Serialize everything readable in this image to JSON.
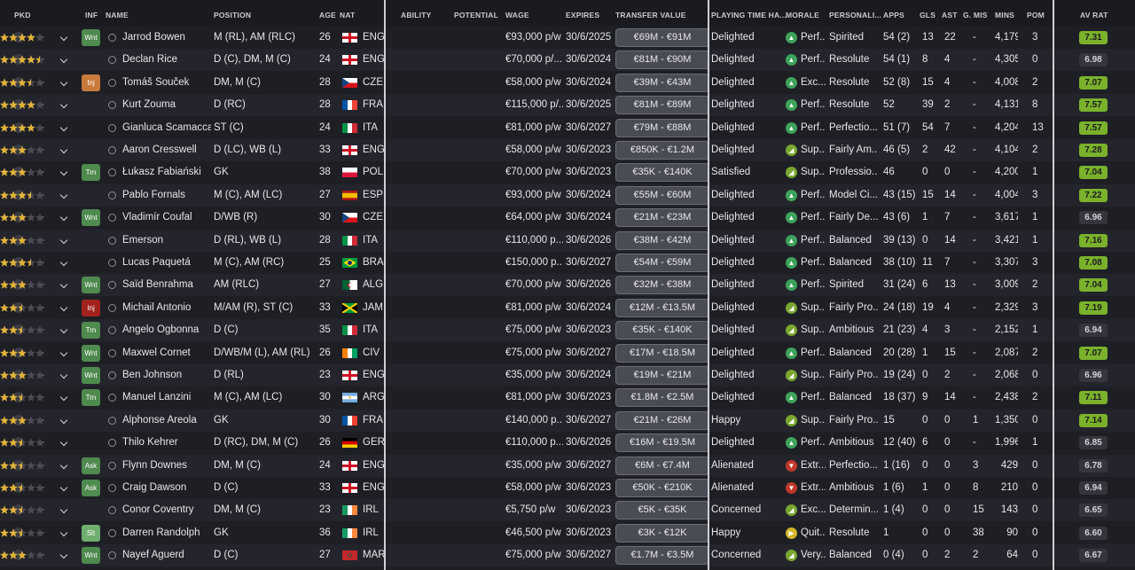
{
  "headers": {
    "pkd": "PKD",
    "inf": "INF",
    "name": "NAME",
    "position": "POSITION",
    "age": "AGE",
    "nat": "NAT",
    "ability": "ABILITY",
    "potential": "POTENTIAL",
    "wage": "WAGE",
    "expires": "EXPIRES",
    "transfer_value": "TRANSFER VALUE",
    "playing_time": "PLAYING TIME HA...",
    "morale": "MORALE",
    "personality": "PERSONALI...",
    "apps": "APPS",
    "gls": "GLS",
    "ast": "AST",
    "gmis": "G. MIS",
    "mins": "MINS",
    "pom": "POM",
    "av_rat": "AV RAT"
  },
  "colors": {
    "tag_wnt": "#4f8a4f",
    "tag_trn": "#4f8a4f",
    "tag_ask": "#4f8a4f",
    "tag_slt": "#4f8a4f",
    "tag_inj": "#c87a3a",
    "tag_inj_red": "#a3221d",
    "morale_perf": "#3ea35a",
    "morale_up": "#7aa62f",
    "morale_down": "#c0392b",
    "morale_quiet": "#d4b52a",
    "rating_green": "#7ab22c",
    "rating_dark": "#35363d",
    "star": "#e2b33a"
  },
  "rows": [
    {
      "pkd": "-",
      "inf": "Wnt",
      "inf_type": "wnt",
      "name": "Jarrod Bowen",
      "position": "M (RL), AM (RLC)",
      "age": "26",
      "flag": "eng",
      "nat": "ENG",
      "ability": 4,
      "potential": 4,
      "wage": "€93,000 p/w",
      "expires": "30/6/2025",
      "tv": "€69M - €91M",
      "pt": "Delighted",
      "morale_icon": "perf",
      "morale": "Perf...",
      "personality": "Spirited",
      "apps": "54 (2)",
      "gls": "13",
      "ast": "22",
      "gmis": "-",
      "mins": "4,179",
      "pom": "3",
      "avr": "7.31",
      "avr_hi": true
    },
    {
      "pkd": "-",
      "inf": "",
      "inf_type": "",
      "name": "Declan Rice",
      "position": "D (C), DM, M (C)",
      "age": "24",
      "flag": "eng",
      "nat": "ENG",
      "ability": 4.5,
      "potential": 4.5,
      "wage": "€70,000 p/...",
      "expires": "30/6/2024",
      "tv": "€81M - €90M",
      "pt": "Delighted",
      "morale_icon": "perf",
      "morale": "Perf...",
      "personality": "Resolute",
      "apps": "54 (1)",
      "gls": "8",
      "ast": "4",
      "gmis": "-",
      "mins": "4,305",
      "pom": "0",
      "avr": "6.98",
      "avr_hi": false
    },
    {
      "pkd": "-",
      "inf": "Inj",
      "inf_type": "inj",
      "name": "Tomáš Souček",
      "position": "DM, M (C)",
      "age": "28",
      "flag": "cze",
      "nat": "CZE",
      "ability": 3.5,
      "potential": 3.5,
      "wage": "€58,000 p/w",
      "expires": "30/6/2024",
      "tv": "€39M - €43M",
      "pt": "Delighted",
      "morale_icon": "perf",
      "morale": "Exc...",
      "personality": "Resolute",
      "apps": "52 (8)",
      "gls": "15",
      "ast": "4",
      "gmis": "-",
      "mins": "4,008",
      "pom": "2",
      "avr": "7.07",
      "avr_hi": true
    },
    {
      "pkd": "-",
      "inf": "",
      "inf_type": "",
      "name": "Kurt Zouma",
      "position": "D (RC)",
      "age": "28",
      "flag": "fra",
      "nat": "FRA",
      "ability": 4,
      "potential": 4,
      "wage": "€115,000 p/...",
      "expires": "30/6/2025",
      "tv": "€81M - €89M",
      "pt": "Delighted",
      "morale_icon": "perf",
      "morale": "Perf...",
      "personality": "Resolute",
      "apps": "52",
      "gls": "39",
      "ast": "2",
      "gmis": "-",
      "mins": "4,131",
      "pom": "8",
      "avr": "7.57",
      "avr_hi": true
    },
    {
      "pkd": "-",
      "inf": "",
      "inf_type": "",
      "name": "Gianluca Scamacca",
      "position": "ST (C)",
      "age": "24",
      "flag": "ita",
      "nat": "ITA",
      "ability": 3.5,
      "potential": 4,
      "wage": "€81,000 p/w",
      "expires": "30/6/2027",
      "tv": "€79M - €88M",
      "pt": "Delighted",
      "morale_icon": "perf",
      "morale": "Perf...",
      "personality": "Perfectio...",
      "apps": "51 (7)",
      "gls": "54",
      "ast": "7",
      "gmis": "-",
      "mins": "4,204",
      "pom": "13",
      "avr": "7.57",
      "avr_hi": true
    },
    {
      "pkd": "-",
      "inf": "",
      "inf_type": "",
      "name": "Aaron Cresswell",
      "position": "D (LC), WB (L)",
      "age": "33",
      "flag": "eng",
      "nat": "ENG",
      "ability": 3,
      "potential": 3,
      "wage": "€58,000 p/w",
      "expires": "30/6/2023",
      "tv": "€850K - €1.2M",
      "pt": "Delighted",
      "morale_icon": "up",
      "morale": "Sup...",
      "personality": "Fairly Am...",
      "apps": "46 (5)",
      "gls": "2",
      "ast": "42",
      "gmis": "-",
      "mins": "4,104",
      "pom": "2",
      "avr": "7.28",
      "avr_hi": true
    },
    {
      "pkd": "-",
      "inf": "Trn",
      "inf_type": "trn",
      "name": "Łukasz Fabiański",
      "position": "GK",
      "age": "38",
      "flag": "pol",
      "nat": "POL",
      "ability": 3,
      "potential": 3,
      "wage": "€70,000 p/w",
      "expires": "30/6/2023",
      "tv": "€35K - €140K",
      "pt": "Satisfied",
      "morale_icon": "up",
      "morale": "Sup...",
      "personality": "Professio...",
      "apps": "46",
      "gls": "0",
      "ast": "0",
      "gmis": "-",
      "mins": "4,200",
      "pom": "1",
      "avr": "7.04",
      "avr_hi": true
    },
    {
      "pkd": "-",
      "inf": "",
      "inf_type": "",
      "name": "Pablo Fornals",
      "position": "M (C), AM (LC)",
      "age": "27",
      "flag": "esp",
      "nat": "ESP",
      "ability": 3.5,
      "potential": 3.5,
      "wage": "€93,000 p/w",
      "expires": "30/6/2024",
      "tv": "€55M - €60M",
      "pt": "Delighted",
      "morale_icon": "perf",
      "morale": "Perf...",
      "personality": "Model Ci...",
      "apps": "43 (15)",
      "gls": "15",
      "ast": "14",
      "gmis": "-",
      "mins": "4,004",
      "pom": "3",
      "avr": "7.22",
      "avr_hi": true
    },
    {
      "pkd": "-",
      "inf": "Wnt",
      "inf_type": "wnt",
      "name": "Vladimír Coufal",
      "position": "D/WB (R)",
      "age": "30",
      "flag": "cze",
      "nat": "CZE",
      "ability": 3,
      "potential": 3,
      "wage": "€64,000 p/w",
      "expires": "30/6/2024",
      "tv": "€21M - €23M",
      "pt": "Delighted",
      "morale_icon": "perf",
      "morale": "Perf...",
      "personality": "Fairly De...",
      "apps": "43 (6)",
      "gls": "1",
      "ast": "7",
      "gmis": "-",
      "mins": "3,617",
      "pom": "1",
      "avr": "6.96",
      "avr_hi": false
    },
    {
      "pkd": "-",
      "inf": "",
      "inf_type": "",
      "name": "Emerson",
      "position": "D (RL), WB (L)",
      "age": "28",
      "flag": "ita",
      "nat": "ITA",
      "ability": 3,
      "potential": 3,
      "wage": "€110,000 p...",
      "expires": "30/6/2026",
      "tv": "€38M - €42M",
      "pt": "Delighted",
      "morale_icon": "perf",
      "morale": "Perf...",
      "personality": "Balanced",
      "apps": "39 (13)",
      "gls": "0",
      "ast": "14",
      "gmis": "-",
      "mins": "3,421",
      "pom": "1",
      "avr": "7.16",
      "avr_hi": true
    },
    {
      "pkd": "-",
      "inf": "",
      "inf_type": "",
      "name": "Lucas Paquetá",
      "position": "M (C), AM (RC)",
      "age": "25",
      "flag": "bra",
      "nat": "BRA",
      "ability": 3.5,
      "potential": 3.5,
      "wage": "€150,000 p...",
      "expires": "30/6/2027",
      "tv": "€54M - €59M",
      "pt": "Delighted",
      "morale_icon": "perf",
      "morale": "Perf...",
      "personality": "Balanced",
      "apps": "38 (10)",
      "gls": "11",
      "ast": "7",
      "gmis": "-",
      "mins": "3,307",
      "pom": "3",
      "avr": "7.08",
      "avr_hi": true
    },
    {
      "pkd": "-",
      "inf": "Wnt",
      "inf_type": "wnt",
      "name": "Saïd Benrahma",
      "position": "AM (RLC)",
      "age": "27",
      "flag": "alg",
      "nat": "ALG",
      "ability": 3,
      "potential": 3,
      "wage": "€70,000 p/w",
      "expires": "30/6/2026",
      "tv": "€32M - €38M",
      "pt": "Delighted",
      "morale_icon": "perf",
      "morale": "Perf...",
      "personality": "Spirited",
      "apps": "31 (24)",
      "gls": "6",
      "ast": "13",
      "gmis": "-",
      "mins": "3,009",
      "pom": "2",
      "avr": "7.04",
      "avr_hi": true
    },
    {
      "pkd": "-",
      "inf": "Inj",
      "inf_type": "injred",
      "name": "Michail Antonio",
      "position": "M/AM (R), ST (C)",
      "age": "33",
      "flag": "jam",
      "nat": "JAM",
      "ability": 2.5,
      "potential": 2.5,
      "wage": "€81,000 p/w",
      "expires": "30/6/2024",
      "tv": "€12M - €13.5M",
      "pt": "Delighted",
      "morale_icon": "up",
      "morale": "Sup...",
      "personality": "Fairly Pro...",
      "apps": "24 (18)",
      "gls": "19",
      "ast": "4",
      "gmis": "-",
      "mins": "2,329",
      "pom": "3",
      "avr": "7.19",
      "avr_hi": true
    },
    {
      "pkd": "-",
      "inf": "Trn",
      "inf_type": "trn",
      "name": "Angelo Ogbonna",
      "position": "D (C)",
      "age": "35",
      "flag": "ita",
      "nat": "ITA",
      "ability": 2.5,
      "potential": 2.5,
      "wage": "€75,000 p/w",
      "expires": "30/6/2023",
      "tv": "€35K - €140K",
      "pt": "Delighted",
      "morale_icon": "up",
      "morale": "Sup...",
      "personality": "Ambitious",
      "apps": "21 (23)",
      "gls": "4",
      "ast": "3",
      "gmis": "-",
      "mins": "2,152",
      "pom": "1",
      "avr": "6.94",
      "avr_hi": false
    },
    {
      "pkd": "-",
      "inf": "Wnt",
      "inf_type": "wnt",
      "name": "Maxwel Cornet",
      "position": "D/WB/M (L), AM (RL)",
      "age": "26",
      "flag": "civ",
      "nat": "CIV",
      "ability": 2.5,
      "potential": 3,
      "wage": "€75,000 p/w",
      "expires": "30/6/2027",
      "tv": "€17M - €18.5M",
      "pt": "Delighted",
      "morale_icon": "perf",
      "morale": "Perf...",
      "personality": "Balanced",
      "apps": "20 (28)",
      "gls": "1",
      "ast": "15",
      "gmis": "-",
      "mins": "2,087",
      "pom": "2",
      "avr": "7.07",
      "avr_hi": true
    },
    {
      "pkd": "-",
      "inf": "Wnt",
      "inf_type": "wnt",
      "name": "Ben Johnson",
      "position": "D (RL)",
      "age": "23",
      "flag": "eng",
      "nat": "ENG",
      "ability": 2.5,
      "potential": 3,
      "wage": "€35,000 p/w",
      "expires": "30/6/2024",
      "tv": "€19M - €21M",
      "pt": "Delighted",
      "morale_icon": "up",
      "morale": "Sup...",
      "personality": "Fairly Pro...",
      "apps": "19 (24)",
      "gls": "0",
      "ast": "2",
      "gmis": "-",
      "mins": "2,068",
      "pom": "0",
      "avr": "6.96",
      "avr_hi": false
    },
    {
      "pkd": "-",
      "inf": "Trn",
      "inf_type": "trn",
      "name": "Manuel Lanzini",
      "position": "M (C), AM (LC)",
      "age": "30",
      "flag": "arg",
      "nat": "ARG",
      "ability": 2.5,
      "potential": 2.5,
      "wage": "€81,000 p/w",
      "expires": "30/6/2023",
      "tv": "€1.8M - €2.5M",
      "pt": "Delighted",
      "morale_icon": "perf",
      "morale": "Perf...",
      "personality": "Balanced",
      "apps": "18 (37)",
      "gls": "9",
      "ast": "14",
      "gmis": "-",
      "mins": "2,438",
      "pom": "2",
      "avr": "7.11",
      "avr_hi": true
    },
    {
      "pkd": "-",
      "inf": "",
      "inf_type": "",
      "name": "Alphonse Areola",
      "position": "GK",
      "age": "30",
      "flag": "fra",
      "nat": "FRA",
      "ability": 3,
      "potential": 3,
      "wage": "€140,000 p...",
      "expires": "30/6/2027",
      "tv": "€21M - €26M",
      "pt": "Happy",
      "morale_icon": "up",
      "morale": "Sup...",
      "personality": "Fairly Pro...",
      "apps": "15",
      "gls": "0",
      "ast": "0",
      "gmis": "1",
      "mins": "1,350",
      "pom": "0",
      "avr": "7.14",
      "avr_hi": true
    },
    {
      "pkd": "-",
      "inf": "",
      "inf_type": "",
      "name": "Thilo Kehrer",
      "position": "D (RC), DM, M (C)",
      "age": "26",
      "flag": "ger",
      "nat": "GER",
      "ability": 2.5,
      "potential": 2.5,
      "wage": "€110,000 p...",
      "expires": "30/6/2026",
      "tv": "€16M - €19.5M",
      "pt": "Delighted",
      "morale_icon": "perf",
      "morale": "Perf...",
      "personality": "Ambitious",
      "apps": "12 (40)",
      "gls": "6",
      "ast": "0",
      "gmis": "-",
      "mins": "1,996",
      "pom": "1",
      "avr": "6.85",
      "avr_hi": false
    },
    {
      "pkd": "-",
      "inf": "Ask",
      "inf_type": "ask",
      "name": "Flynn Downes",
      "position": "DM, M (C)",
      "age": "24",
      "flag": "eng",
      "nat": "ENG",
      "ability": 2,
      "potential": 2.5,
      "wage": "€35,000 p/w",
      "expires": "30/6/2027",
      "tv": "€6M - €7.4M",
      "pt": "Alienated",
      "morale_icon": "down",
      "morale": "Extr...",
      "personality": "Perfectio...",
      "apps": "1 (16)",
      "gls": "0",
      "ast": "0",
      "gmis": "3",
      "mins": "429",
      "pom": "0",
      "avr": "6.78",
      "avr_hi": false
    },
    {
      "pkd": "-",
      "inf": "Ask",
      "inf_type": "ask",
      "name": "Craig Dawson",
      "position": "D (C)",
      "age": "33",
      "flag": "eng",
      "nat": "ENG",
      "ability": 2.5,
      "potential": 2.5,
      "wage": "€58,000 p/w",
      "expires": "30/6/2023",
      "tv": "€50K - €210K",
      "pt": "Alienated",
      "morale_icon": "down",
      "morale": "Extr...",
      "personality": "Ambitious",
      "apps": "1 (6)",
      "gls": "1",
      "ast": "0",
      "gmis": "8",
      "mins": "210",
      "pom": "0",
      "avr": "6.94",
      "avr_hi": false
    },
    {
      "pkd": "-",
      "inf": "",
      "inf_type": "",
      "name": "Conor Coventry",
      "position": "DM, M (C)",
      "age": "23",
      "flag": "irl",
      "nat": "IRL",
      "ability": 2,
      "potential": 2.5,
      "wage": "€5,750 p/w",
      "expires": "30/6/2023",
      "tv": "€5K - €35K",
      "pt": "Concerned",
      "morale_icon": "up",
      "morale": "Exc...",
      "personality": "Determin...",
      "apps": "1 (4)",
      "gls": "0",
      "ast": "0",
      "gmis": "15",
      "mins": "143",
      "pom": "0",
      "avr": "6.65",
      "avr_hi": false
    },
    {
      "pkd": "-",
      "inf": "Slt",
      "inf_type": "slt",
      "name": "Darren Randolph",
      "position": "GK",
      "age": "36",
      "flag": "irl",
      "nat": "IRL",
      "ability": 2.5,
      "potential": 2.5,
      "wage": "€46,500 p/w",
      "expires": "30/6/2023",
      "tv": "€3K - €12K",
      "pt": "Happy",
      "morale_icon": "quiet",
      "morale": "Quit...",
      "personality": "Resolute",
      "apps": "1",
      "gls": "0",
      "ast": "0",
      "gmis": "38",
      "mins": "90",
      "pom": "0",
      "avr": "6.60",
      "avr_hi": false
    },
    {
      "pkd": "-",
      "inf": "Wnt",
      "inf_type": "wnt",
      "name": "Nayef Aguerd",
      "position": "D (C)",
      "age": "27",
      "flag": "mar",
      "nat": "MAR",
      "ability": 2.5,
      "potential": 3,
      "wage": "€75,000 p/w",
      "expires": "30/6/2027",
      "tv": "€1.7M - €3.5M",
      "pt": "Concerned",
      "morale_icon": "up",
      "morale": "Very...",
      "personality": "Balanced",
      "apps": "0 (4)",
      "gls": "0",
      "ast": "2",
      "gmis": "2",
      "mins": "64",
      "pom": "0",
      "avr": "6.67",
      "avr_hi": false
    }
  ]
}
